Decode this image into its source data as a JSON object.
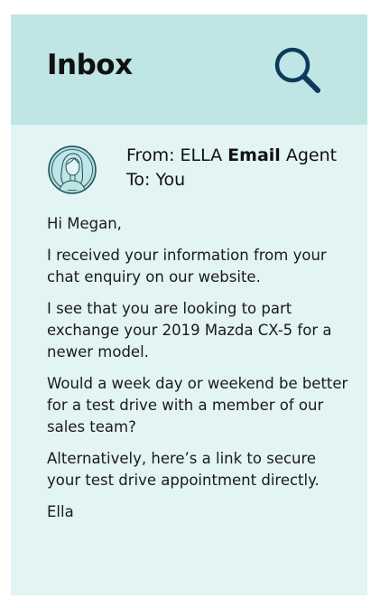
{
  "header": {
    "title": "Inbox",
    "search_icon": "search-icon"
  },
  "email": {
    "from_prefix": "From: ELLA ",
    "from_bold": "Email",
    "from_suffix": " Agent",
    "to": "To: You",
    "avatar_icon": "avatar-woman-icon",
    "paragraphs": [
      "Hi Megan,",
      "I received your information from your chat enquiry on our website.",
      "I see that you are looking to part exchange your 2019 Mazda CX-5 for a newer model.",
      "Would a week day or weekend be better for a test drive with a member of our sales team?",
      "Alternatively, here’s a link to secure your test drive appointment directly.",
      "Ella"
    ]
  },
  "colors": {
    "header_bg": "#bfe5e5",
    "panel_bg": "#e2f4f3",
    "icon_color": "#0b3a5c"
  }
}
